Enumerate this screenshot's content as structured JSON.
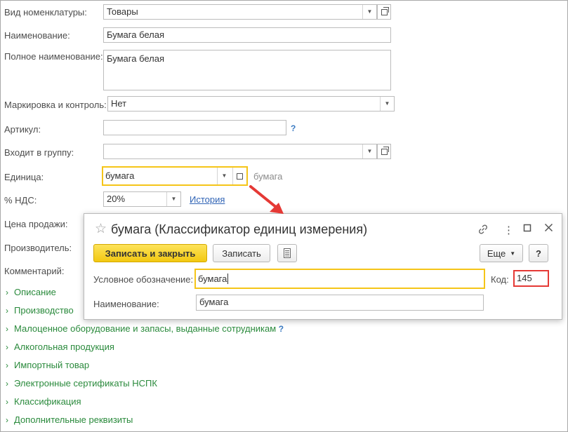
{
  "form": {
    "kind_label": "Вид номенклатуры:",
    "kind_value": "Товары",
    "name_label": "Наименование:",
    "name_value": "Бумага белая",
    "fullname_label": "Полное наименование:",
    "fullname_value": "Бумага белая",
    "marking_label": "Маркировка и контроль:",
    "marking_value": "Нет",
    "article_label": "Артикул:",
    "article_value": "",
    "article_help": "?",
    "group_label": "Входит в группу:",
    "group_value": "",
    "unit_label": "Единица:",
    "unit_value": "бумага",
    "unit_hint": "бумага",
    "vat_label": "% НДС:",
    "vat_value": "20%",
    "vat_history": "История",
    "price_label": "Цена продажи:",
    "manufacturer_label": "Производитель:",
    "comment_label": "Комментарий:"
  },
  "sections": [
    {
      "label": "Описание"
    },
    {
      "label": "Производство"
    },
    {
      "label": "Малоценное оборудование и запасы, выданные сотрудникам",
      "help": "?"
    },
    {
      "label": "Алкогольная продукция"
    },
    {
      "label": "Импортный товар"
    },
    {
      "label": "Электронные сертификаты НСПК"
    },
    {
      "label": "Классификация"
    },
    {
      "label": "Дополнительные реквизиты"
    }
  ],
  "dialog": {
    "title": "бумага (Классификатор единиц измерения)",
    "save_close": "Записать и закрыть",
    "save": "Записать",
    "more": "Еще",
    "help": "?",
    "symbol_label": "Условное обозначение:",
    "symbol_value": "бумага",
    "code_label": "Код:",
    "code_value": "145",
    "name_label": "Наименование:",
    "name_value": "бумага"
  },
  "colors": {
    "focus_border": "#f5c518",
    "primary_button": "#f2c811",
    "section_text": "#2a8a3c",
    "link": "#2f63b5",
    "code_highlight": "#e53935",
    "arrow": "#e53935"
  }
}
